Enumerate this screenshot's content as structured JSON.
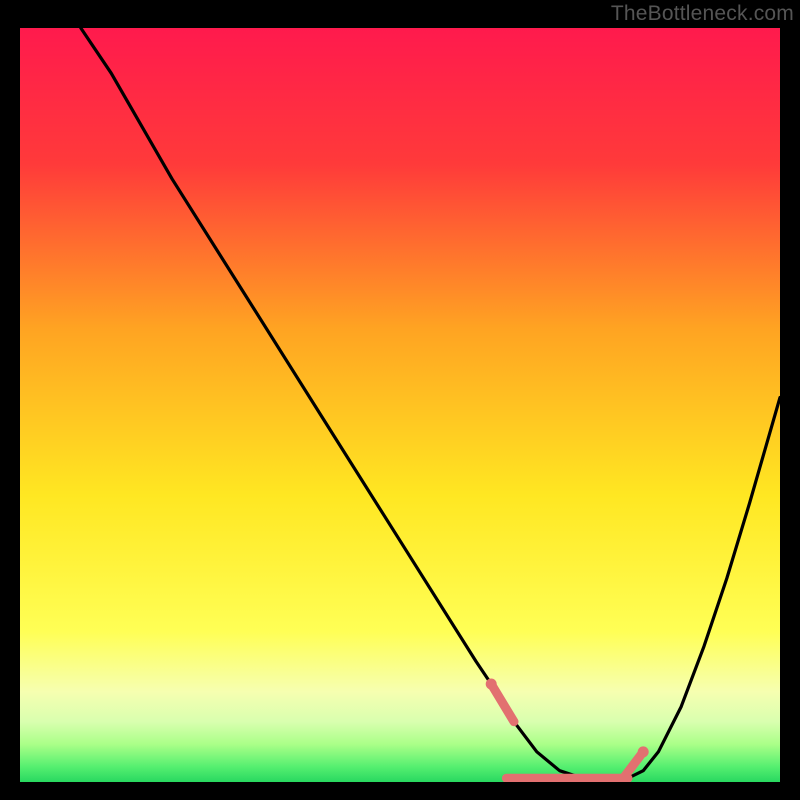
{
  "watermark": "TheBottleneck.com",
  "chart_data": {
    "type": "line",
    "title": "",
    "xlabel": "",
    "ylabel": "",
    "xlim": [
      0,
      100
    ],
    "ylim": [
      0,
      100
    ],
    "grid": false,
    "series": [
      {
        "name": "bottleneck-curve",
        "x": [
          8,
          12,
          20,
          30,
          40,
          50,
          60,
          62,
          65,
          68,
          71,
          74,
          77,
          80,
          82,
          84,
          87,
          90,
          93,
          96,
          100
        ],
        "values": [
          100,
          94,
          80,
          64,
          48,
          32,
          16,
          13,
          8,
          4,
          1.5,
          0.5,
          0.5,
          0.5,
          1.5,
          4,
          10,
          18,
          27,
          37,
          51
        ]
      }
    ],
    "segments": [
      {
        "name": "red-dot-left",
        "x": 62,
        "y": 13
      },
      {
        "name": "red-band",
        "x0": 64,
        "x1": 80,
        "y": 0.5
      },
      {
        "name": "red-dot-right",
        "x": 82,
        "y": 4
      }
    ],
    "gradient_stops": [
      {
        "pct": 0,
        "color": "#ff1a4d"
      },
      {
        "pct": 18,
        "color": "#ff3a3a"
      },
      {
        "pct": 40,
        "color": "#ffa422"
      },
      {
        "pct": 62,
        "color": "#ffe722"
      },
      {
        "pct": 80,
        "color": "#ffff55"
      },
      {
        "pct": 88,
        "color": "#f6ffb0"
      },
      {
        "pct": 92,
        "color": "#d9ffaf"
      },
      {
        "pct": 95,
        "color": "#aaff88"
      },
      {
        "pct": 98,
        "color": "#55ef70"
      },
      {
        "pct": 100,
        "color": "#28d860"
      }
    ]
  }
}
